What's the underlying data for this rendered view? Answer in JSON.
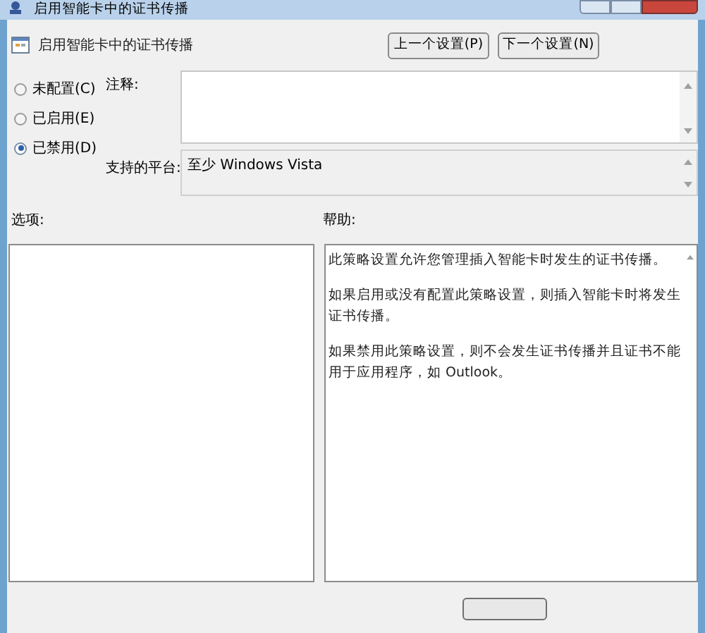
{
  "window": {
    "title": "启用智能卡中的证书传播"
  },
  "header": {
    "title": "启用智能卡中的证书传播",
    "buttons": [
      "上一个设置(P)",
      "下一个设置(N)"
    ]
  },
  "state_options": [
    {
      "label": "未配置(C)",
      "selected": false
    },
    {
      "label": "已启用(E)",
      "selected": false
    },
    {
      "label": "已禁用(D)",
      "selected": true
    }
  ],
  "comment": {
    "label": "注释:"
  },
  "platform": {
    "label": "支持的平台:",
    "value": "至少 Windows Vista"
  },
  "options": {
    "label": "选项:"
  },
  "help": {
    "label": "帮助:",
    "paragraphs": [
      "此策略设置允许您管理插入智能卡时发生的证书传播。",
      "如果启用或没有配置此策略设置，则插入智能卡时将发生证书传播。",
      "如果禁用此策略设置，则不会发生证书传播并且证书不能用于应用程序，如 Outlook。"
    ]
  }
}
